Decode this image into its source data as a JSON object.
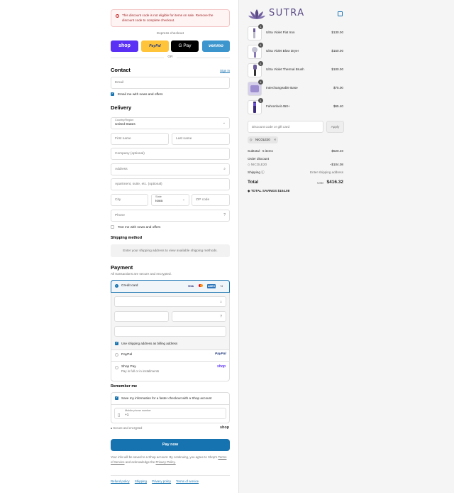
{
  "alert": {
    "message": "This discount code is not eligible for items on sale. Remove the discount code to complete checkout."
  },
  "express": {
    "title": "Express checkout",
    "shop_label": "shop",
    "paypal_label": "PayPal",
    "gpay_label": "G Pay",
    "venmo_label": "venmo",
    "or_label": "OR"
  },
  "contact": {
    "heading": "Contact",
    "sign_in": "Sign in",
    "email_placeholder": "Email",
    "news_label": "Email me with news and offers",
    "news_checked": true
  },
  "delivery": {
    "heading": "Delivery",
    "country_label": "Country/Region",
    "country_value": "United States",
    "first_name": "First name",
    "last_name": "Last name",
    "company": "Company (optional)",
    "address": "Address",
    "apartment": "Apartment, suite, etc. (optional)",
    "city": "City",
    "state_label": "State",
    "state_value": "Iowa",
    "zip": "ZIP code",
    "phone": "Phone",
    "text_news": "Text me with news and offers"
  },
  "shipping": {
    "heading": "Shipping method",
    "message": "Enter your shipping address to view available shipping methods."
  },
  "payment": {
    "heading": "Payment",
    "subtitle": "All transactions are secure and encrypted.",
    "credit_card": "Credit card",
    "cards": [
      "VISA",
      "MC",
      "AMEX",
      "+4"
    ],
    "use_shipping": "Use shipping address as billing address",
    "paypal": "PayPal",
    "paypal_logo": "PayPal",
    "shoppay": "Shop Pay",
    "shoppay_sub": "Pay in full or in installments",
    "shoppay_logo": "shop"
  },
  "remember": {
    "heading": "Remember me",
    "save_label": "Save my information for a faster checkout with a Shop account",
    "phone_label": "Mobile phone number",
    "phone_value": "+1",
    "secure": "Secure and encrypted",
    "shop_logo": "shop"
  },
  "paynow": {
    "label": "Pay now"
  },
  "legal": {
    "text": "Your info will be saved to a Shop account. By continuing, you agree to Shop's",
    "terms": "Terms of Service",
    "and": "and acknowledge the",
    "privacy": "Privacy Policy."
  },
  "footer": {
    "links": [
      "Refund policy",
      "Shipping",
      "Privacy policy",
      "Terms of service"
    ]
  },
  "brand": {
    "name": "SUTRA",
    "color": "#5b4b86"
  },
  "cart": {
    "items": [
      {
        "qty": "1",
        "name": "Ultra Violet Flat Iron",
        "price": "$130.00"
      },
      {
        "qty": "1",
        "name": "Ultra Violet Blow Dryer",
        "price": "$150.00"
      },
      {
        "qty": "1",
        "name": "Ultra Violet Thermal Brush",
        "price": "$100.00"
      },
      {
        "qty": "1",
        "name": "Interchangeable Base",
        "price": "$75.00"
      },
      {
        "qty": "1",
        "name": "Fahrenheit 450+",
        "price": "$65.40"
      }
    ],
    "discount_placeholder": "Discount code or gift card",
    "apply": "Apply",
    "code_tag": "NICOLE20",
    "subtotal_label": "Subtotal · 5 items",
    "subtotal": "$520.40",
    "order_discount": "Order discount",
    "discount_code": "NICOLE20",
    "discount_value": "−$104.08",
    "shipping_label": "Shipping",
    "shipping_value": "Enter shipping address",
    "total_label": "Total",
    "currency": "USD",
    "total": "$416.32",
    "savings_label": "TOTAL SAVINGS",
    "savings": "$104.08"
  },
  "colors": {
    "accent": "#1773b0",
    "shop": "#5a31f4",
    "paypal": "#ffc439",
    "venmo": "#3d95ce",
    "alert": "#c41d1d"
  }
}
